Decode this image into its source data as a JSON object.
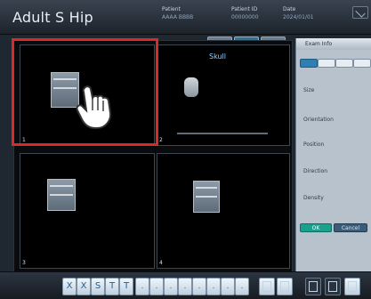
{
  "app": {
    "title": "Adult S Hip"
  },
  "header": {
    "info": [
      {
        "label": "Patient",
        "value": "AAAA BBBB"
      },
      {
        "label": "Patient ID",
        "value": "00000000"
      },
      {
        "label": "Date",
        "value": "2024/01/01"
      }
    ]
  },
  "viewer": {
    "tiles": [
      {
        "label": "1",
        "thumb_caption": "AP"
      },
      {
        "label": "2",
        "header": "Skull"
      },
      {
        "label": "3",
        "thumb_caption": "AP"
      },
      {
        "label": "4",
        "thumb_caption": "LAT"
      }
    ]
  },
  "right_panel": {
    "header": "Exam Info",
    "rows": [
      "Size",
      "Orientation",
      "Position",
      "Direction",
      "Density"
    ],
    "ok_label": "OK",
    "other_label": "Cancel"
  },
  "toolbar": {
    "tools": [
      "X",
      "X",
      "S",
      "T",
      "T",
      "-",
      "-",
      "-",
      "-",
      "-",
      "-",
      "-",
      "-"
    ]
  },
  "colors": {
    "highlight": "#d72b2b",
    "accent": "#2f7fb3",
    "ok": "#1aa08d"
  }
}
